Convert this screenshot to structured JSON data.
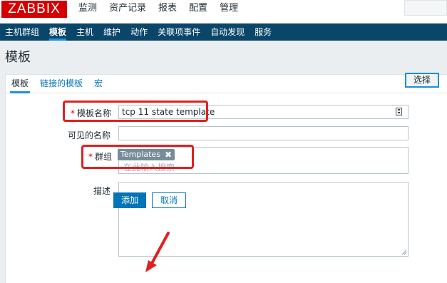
{
  "brand": {
    "logo": "ZABBIX"
  },
  "topnav": [
    "监测",
    "资产记录",
    "报表",
    "配置",
    "管理"
  ],
  "subnav": [
    "主机群组",
    "模板",
    "主机",
    "维护",
    "动作",
    "关联项事件",
    "自动发现",
    "服务"
  ],
  "page": {
    "title": "模板"
  },
  "tabs": [
    "模板",
    "链接的模板",
    "宏"
  ],
  "form": {
    "required_mark": "*",
    "template_name_label": "模板名称",
    "template_name_value": "tcp 11 state template",
    "visible_name_label": "可见的名称",
    "groups_label": "群组",
    "group_tag": "Templates",
    "group_tag_close": "✖",
    "groups_placeholder": "在此输入搜索",
    "select_button": "选择",
    "description_label": "描述",
    "add_button": "添加",
    "cancel_button": "取消"
  },
  "colors": {
    "brand": "#d40000",
    "nav_bg": "#0a466a",
    "primary": "#0275b8",
    "annotation": "#e02020"
  }
}
